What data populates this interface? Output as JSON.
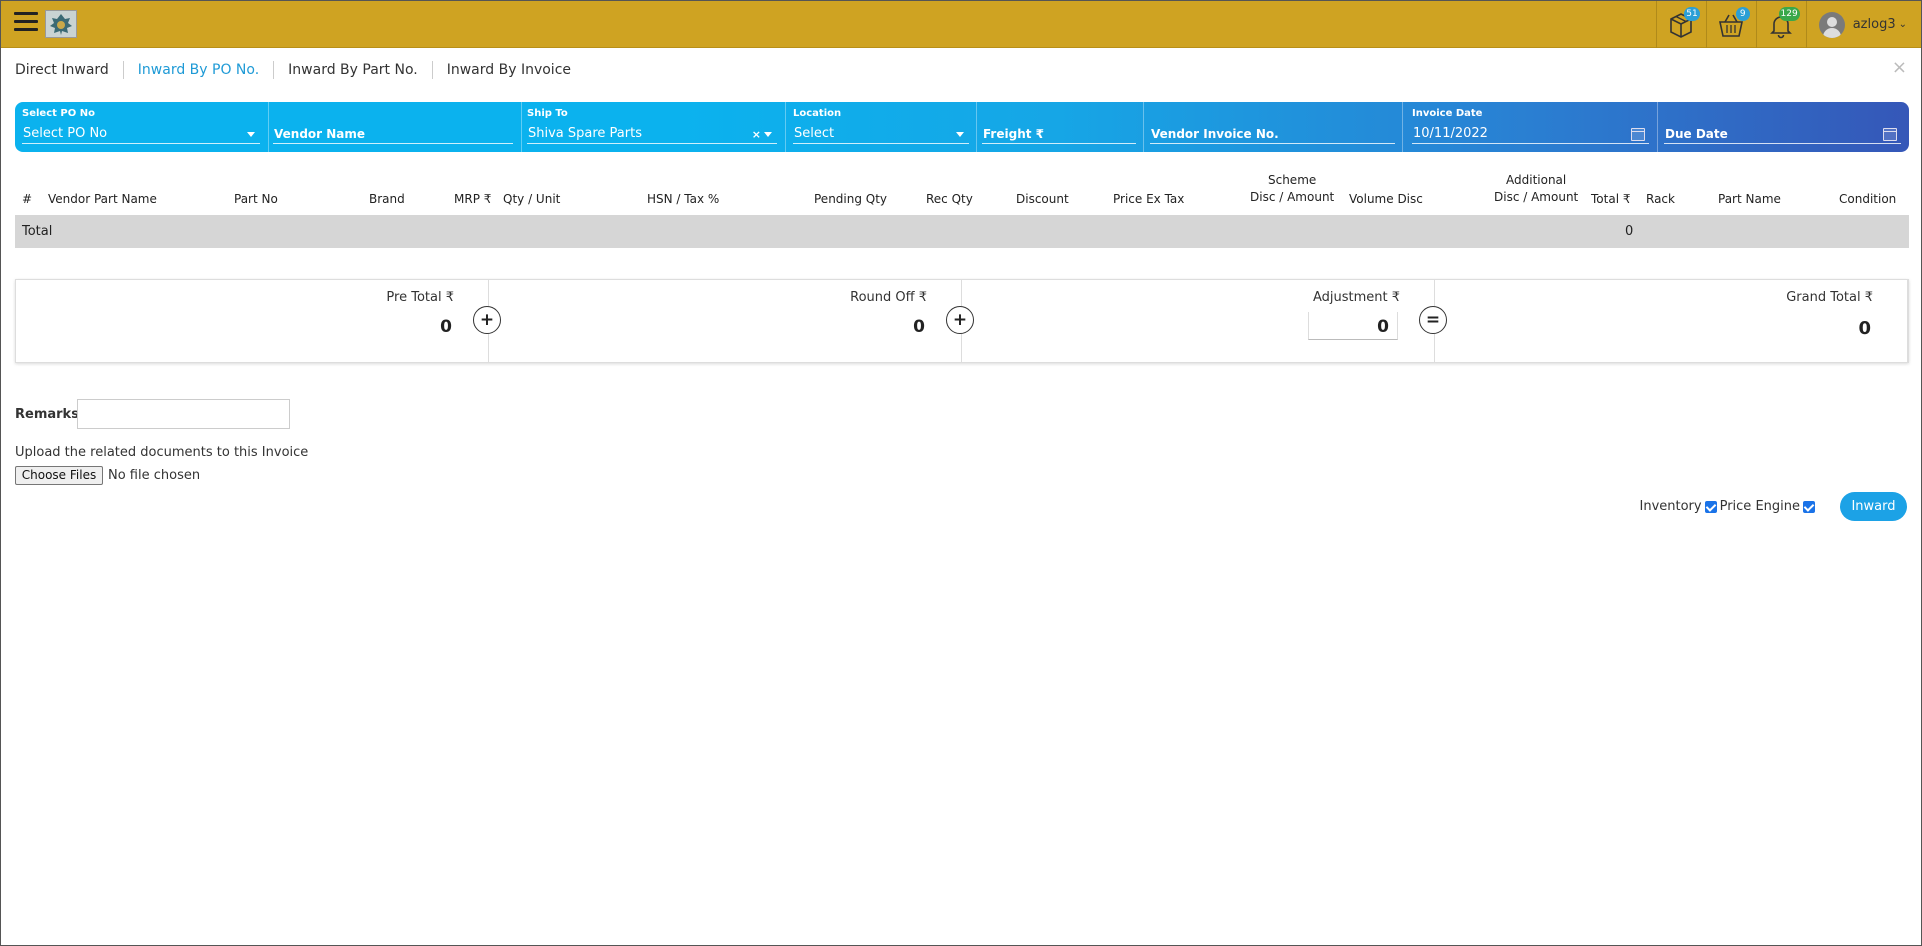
{
  "header": {
    "menu_icon": "hamburger-menu-icon",
    "logo_icon": "company-logo-icon",
    "icons": [
      {
        "name": "package-icon",
        "badge": "51",
        "badge_color": "#2b9fd6"
      },
      {
        "name": "basket-icon",
        "badge": "9",
        "badge_color": "#2b9fd6"
      },
      {
        "name": "bell-icon",
        "badge": "129",
        "badge_color": "#39a84a"
      }
    ],
    "user": {
      "name": "azlog3",
      "chevron": "⌄"
    }
  },
  "tabs": [
    {
      "label": "Direct Inward",
      "active": false
    },
    {
      "label": "Inward By PO No.",
      "active": true
    },
    {
      "label": "Inward By Part No.",
      "active": false
    },
    {
      "label": "Inward By Invoice",
      "active": false
    }
  ],
  "close_label": "×",
  "filters": {
    "po": {
      "label": "Select PO No",
      "value": "Select PO No"
    },
    "vendor_name": {
      "placeholder": "Vendor Name"
    },
    "ship_to": {
      "label": "Ship To",
      "value": "Shiva Spare Parts",
      "clear": "×"
    },
    "location": {
      "label": "Location",
      "value": "Select"
    },
    "freight": {
      "placeholder": "Freight ₹"
    },
    "vendor_invoice": {
      "placeholder": "Vendor Invoice No."
    },
    "invoice_date": {
      "label": "Invoice Date",
      "value": "10/11/2022"
    },
    "due_date": {
      "placeholder": "Due Date"
    }
  },
  "table": {
    "columns": [
      "#",
      "Vendor Part Name",
      "Part No",
      "Brand",
      "MRP ₹",
      "Qty / Unit",
      "HSN / Tax %",
      "Pending Qty",
      "Rec Qty",
      "Discount",
      "Price Ex Tax",
      "Scheme",
      "Disc / Amount",
      "Volume Disc",
      "Additional",
      "Disc / Amount",
      "Total ₹",
      "Rack",
      "Part Name",
      "Condition"
    ],
    "total_label": "Total",
    "total_value": "0"
  },
  "summary": {
    "pre_total": {
      "label": "Pre Total ₹",
      "value": "0"
    },
    "round_off": {
      "label": "Round Off ₹",
      "value": "0"
    },
    "adjustment": {
      "label": "Adjustment ₹",
      "value": "0"
    },
    "grand_total": {
      "label": "Grand Total ₹",
      "value": "0"
    },
    "ops": [
      "+",
      "+",
      "="
    ]
  },
  "remarks": {
    "label": "Remarks",
    "value": ""
  },
  "upload": {
    "label": "Upload the related documents to this Invoice",
    "button": "Choose Files",
    "status": "No file chosen"
  },
  "options": {
    "inventory_label": "Inventory",
    "inventory_checked": true,
    "price_engine_label": "Price Engine",
    "price_engine_checked": true
  },
  "inward_button": "Inward"
}
